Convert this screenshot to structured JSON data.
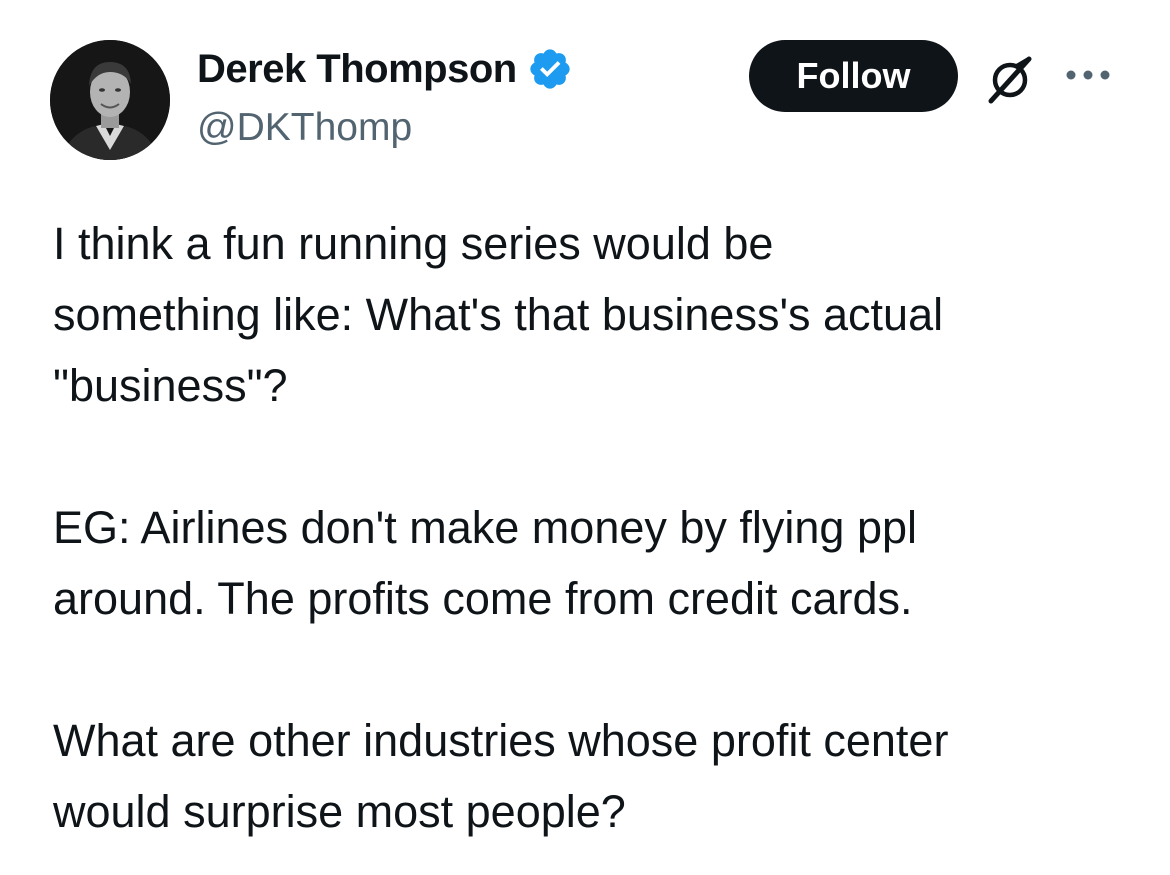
{
  "author": {
    "display_name": "Derek Thompson",
    "handle": "@DKThomp",
    "verified": true,
    "verified_color": "#1d9bf0"
  },
  "actions": {
    "follow_label": "Follow",
    "grok_icon": "grok-icon",
    "more_icon": "more-icon"
  },
  "tweet": {
    "paragraphs": [
      [
        "I think a fun running series would be",
        "something like: What's that business's actual",
        "\"business\"?"
      ],
      [
        "EG: Airlines don't make money by flying ppl",
        "around. The profits come from credit cards."
      ],
      [
        "What are other industries whose profit center",
        "would surprise most people?"
      ]
    ]
  },
  "colors": {
    "text": "#0f1419",
    "secondary_text": "#536471",
    "follow_bg": "#0f1419",
    "follow_text": "#ffffff"
  }
}
